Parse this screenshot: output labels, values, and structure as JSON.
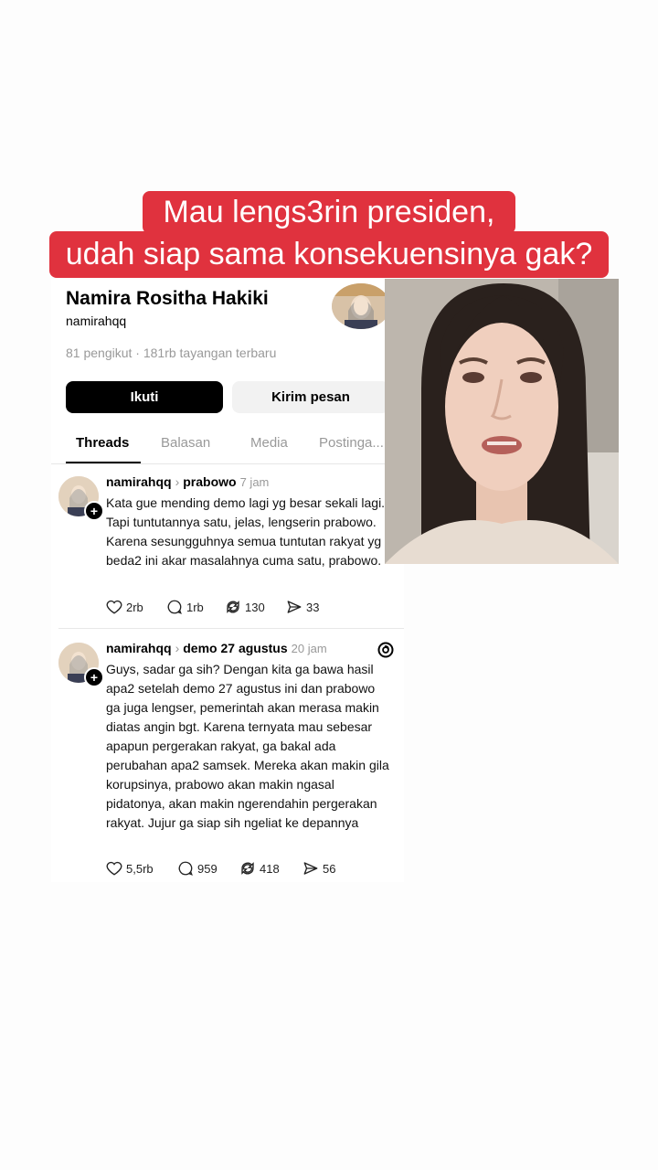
{
  "caption": {
    "line1": "Mau lengs3rin presiden,",
    "line2": "udah siap sama konsekuensinya gak?",
    "bg_color": "#e0323e"
  },
  "profile": {
    "name": "Namira Rositha Hakiki",
    "handle": "namirahqq",
    "stats": "81 pengikut · 181rb tayangan terbaru",
    "follow_label": "Ikuti",
    "message_label": "Kirim pesan",
    "tabs": [
      "Threads",
      "Balasan",
      "Media",
      "Postinga..."
    ]
  },
  "posts": [
    {
      "user": "namirahqq",
      "topic": "prabowo",
      "time": "7 jam",
      "text": "Kata gue mending demo lagi yg besar sekali lagi. Tapi tuntutannya satu, jelas, lengserin prabowo. Karena sesungguhnya semua tuntutan rakyat yg beda2 ini akar masalahnya cuma satu, prabowo.",
      "likes": "2rb",
      "replies": "1rb",
      "reposts": "130",
      "shares": "33"
    },
    {
      "user": "namirahqq",
      "topic": "demo 27 agustus",
      "time": "20 jam",
      "text": "Guys, sadar ga sih? Dengan kita ga bawa hasil apa2 setelah demo 27 agustus ini dan prabowo ga juga lengser, pemerintah akan merasa makin diatas angin bgt. Karena ternyata mau sebesar apapun pergerakan rakyat, ga bakal ada perubahan apa2 samsek. Mereka akan makin gila korupsinya, prabowo akan makin ngasal pidatonya, akan makin ngerendahin pergerakan rakyat. Jujur ga siap sih ngeliat ke depannya",
      "likes": "5,5rb",
      "replies": "959",
      "reposts": "418",
      "shares": "56"
    }
  ]
}
